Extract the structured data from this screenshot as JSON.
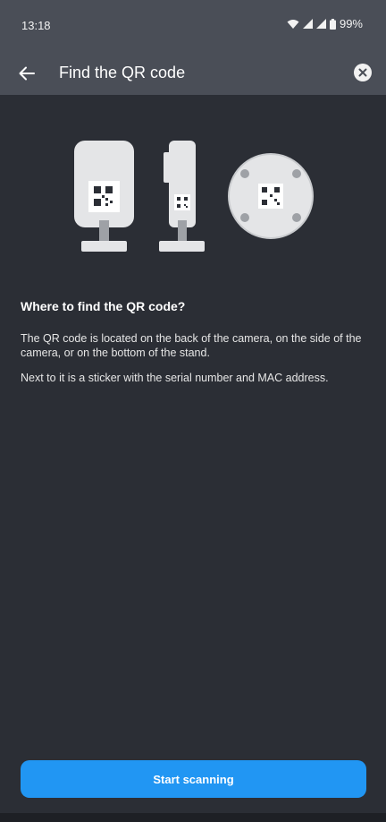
{
  "status_bar": {
    "time": "13:18",
    "battery": "99%",
    "icons": [
      "wifi-icon",
      "signal-icon",
      "signal-icon",
      "battery-icon"
    ]
  },
  "header": {
    "title": "Find the QR code",
    "back_icon": "arrow-left-icon",
    "close_icon": "close-circle-icon"
  },
  "illustration": {
    "items": [
      "camera-back-with-qr",
      "camera-side-with-qr",
      "stand-bottom-with-qr"
    ]
  },
  "content": {
    "heading": "Where to find the QR code?",
    "paragraph_1": "The QR code is located on the back of the camera, on the side of the camera, or on the bottom of the stand.",
    "paragraph_2": "Next to it is a sticker with the serial number and MAC address."
  },
  "actions": {
    "start_label": "Start scanning"
  },
  "colors": {
    "background": "#2b2e35",
    "header": "#4a4e57",
    "accent": "#2196f3"
  }
}
